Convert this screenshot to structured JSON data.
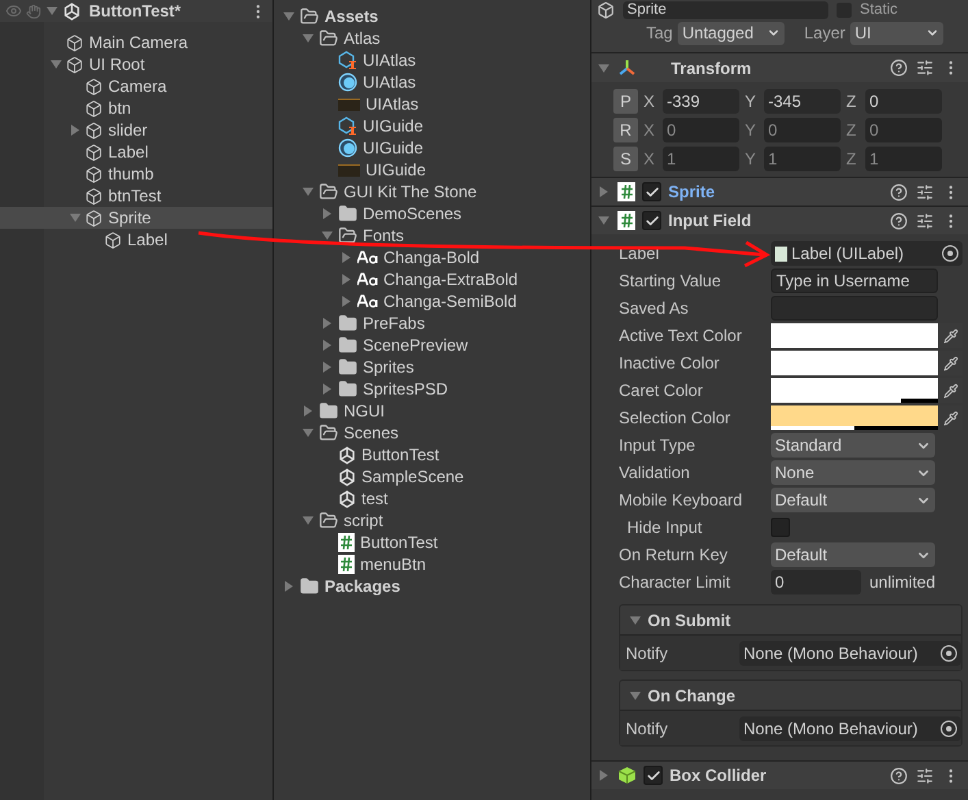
{
  "hierarchy": {
    "scene": {
      "label": "ButtonTest*",
      "expanded": true
    },
    "items": [
      {
        "label": "Main Camera",
        "selected": false
      },
      {
        "label": "UI Root",
        "selected": false,
        "expanded": true,
        "children": [
          {
            "label": "Camera",
            "selected": false
          },
          {
            "label": "btn",
            "selected": false
          },
          {
            "label": "slider",
            "selected": false,
            "expanded": false
          },
          {
            "label": "Label",
            "selected": false
          },
          {
            "label": "thumb",
            "selected": false
          },
          {
            "label": "btnTest",
            "selected": false
          },
          {
            "label": "Sprite",
            "selected": true,
            "expanded": true,
            "children": [
              {
                "label": "Label",
                "selected": false
              }
            ]
          }
        ]
      }
    ]
  },
  "project": {
    "items": [
      {
        "label": "Assets",
        "kind": "folder",
        "bold": true,
        "expanded": true,
        "children": [
          {
            "label": "Atlas",
            "kind": "folder",
            "expanded": true,
            "children": [
              {
                "label": "UIAtlas",
                "kind": "prefab"
              },
              {
                "label": "UIAtlas",
                "kind": "material"
              },
              {
                "label": "UIAtlas",
                "kind": "texture"
              },
              {
                "label": "UIGuide",
                "kind": "prefab"
              },
              {
                "label": "UIGuide",
                "kind": "material"
              },
              {
                "label": "UIGuide",
                "kind": "texture"
              }
            ]
          },
          {
            "label": "GUI Kit The Stone",
            "kind": "folder",
            "expanded": true,
            "children": [
              {
                "label": "DemoScenes",
                "kind": "folder",
                "expanded": false
              },
              {
                "label": "Fonts",
                "kind": "folder",
                "expanded": true,
                "children": [
                  {
                    "label": "Changa-Bold",
                    "kind": "font",
                    "expanded": false
                  },
                  {
                    "label": "Changa-ExtraBold",
                    "kind": "font",
                    "expanded": false
                  },
                  {
                    "label": "Changa-SemiBold",
                    "kind": "font",
                    "expanded": false
                  }
                ]
              },
              {
                "label": "PreFabs",
                "kind": "folder",
                "expanded": false
              },
              {
                "label": "ScenePreview",
                "kind": "folder",
                "expanded": false
              },
              {
                "label": "Sprites",
                "kind": "folder",
                "expanded": false
              },
              {
                "label": "SpritesPSD",
                "kind": "folder",
                "expanded": false
              }
            ]
          },
          {
            "label": "NGUI",
            "kind": "folder",
            "expanded": false
          },
          {
            "label": "Scenes",
            "kind": "folder",
            "expanded": true,
            "children": [
              {
                "label": "ButtonTest",
                "kind": "scene"
              },
              {
                "label": "SampleScene",
                "kind": "scene"
              },
              {
                "label": "test",
                "kind": "scene"
              }
            ]
          },
          {
            "label": "script",
            "kind": "folder",
            "expanded": true,
            "children": [
              {
                "label": "ButtonTest",
                "kind": "script"
              },
              {
                "label": "menuBtn",
                "kind": "script"
              }
            ]
          }
        ]
      },
      {
        "label": "Packages",
        "kind": "folder",
        "bold": true,
        "expanded": false
      }
    ]
  },
  "inspector": {
    "name": "Sprite",
    "static_label": "Static",
    "static_checked": false,
    "tag_label": "Tag",
    "tag": "Untagged",
    "layer_label": "Layer",
    "layer": "UI",
    "transform": {
      "title": "Transform",
      "expanded": true,
      "rows": [
        {
          "button": "P",
          "fields": [
            {
              "axis": "X",
              "value": "-339"
            },
            {
              "axis": "Y",
              "value": "-345"
            },
            {
              "axis": "Z",
              "value": "0"
            }
          ]
        },
        {
          "button": "R",
          "fields": [
            {
              "axis": "X",
              "value": "0"
            },
            {
              "axis": "Y",
              "value": "0"
            },
            {
              "axis": "Z",
              "value": "0"
            }
          ]
        },
        {
          "button": "S",
          "fields": [
            {
              "axis": "X",
              "value": "1"
            },
            {
              "axis": "Y",
              "value": "1"
            },
            {
              "axis": "Z",
              "value": "1"
            }
          ]
        }
      ]
    },
    "sprite": {
      "title": "Sprite",
      "enabled": true,
      "expanded": false
    },
    "input_field": {
      "title": "Input Field",
      "enabled": true,
      "expanded": true,
      "properties": [
        {
          "kind": "object",
          "label": "Label",
          "value": "Label (UILabel)"
        },
        {
          "kind": "text",
          "label": "Starting Value",
          "value": "Type in Username"
        },
        {
          "kind": "text",
          "label": "Saved As"
        },
        {
          "kind": "color",
          "label": "Active Text Color",
          "color": "#ffffff",
          "level": 1
        },
        {
          "kind": "color",
          "label": "Inactive Color",
          "color": "#ffffff",
          "level": 1
        },
        {
          "kind": "color",
          "label": "Caret Color",
          "color": "#ffffff",
          "level": 0.78
        },
        {
          "kind": "color",
          "label": "Selection Color",
          "color": "#ffd98a",
          "level": 0.5
        },
        {
          "kind": "dropdown",
          "label": "Input Type",
          "value": "Standard"
        },
        {
          "kind": "dropdown",
          "label": "Validation",
          "value": "None"
        },
        {
          "kind": "dropdown",
          "label": "Mobile Keyboard",
          "value": "Default"
        },
        {
          "kind": "checkbox",
          "label": "Hide Input",
          "checked": false
        },
        {
          "kind": "dropdown",
          "label": "On Return Key",
          "value": "Default"
        },
        {
          "kind": "number",
          "label": "Character Limit",
          "value": "0",
          "note": "unlimited"
        }
      ],
      "events": [
        {
          "title": "On Submit",
          "expanded": true,
          "label": "Notify",
          "value": "None (Mono Behaviour)"
        },
        {
          "title": "On Change",
          "expanded": true,
          "label": "Notify",
          "value": "None (Mono Behaviour)"
        }
      ]
    },
    "box_collider": {
      "title": "Box Collider",
      "enabled": true,
      "expanded": false
    }
  }
}
